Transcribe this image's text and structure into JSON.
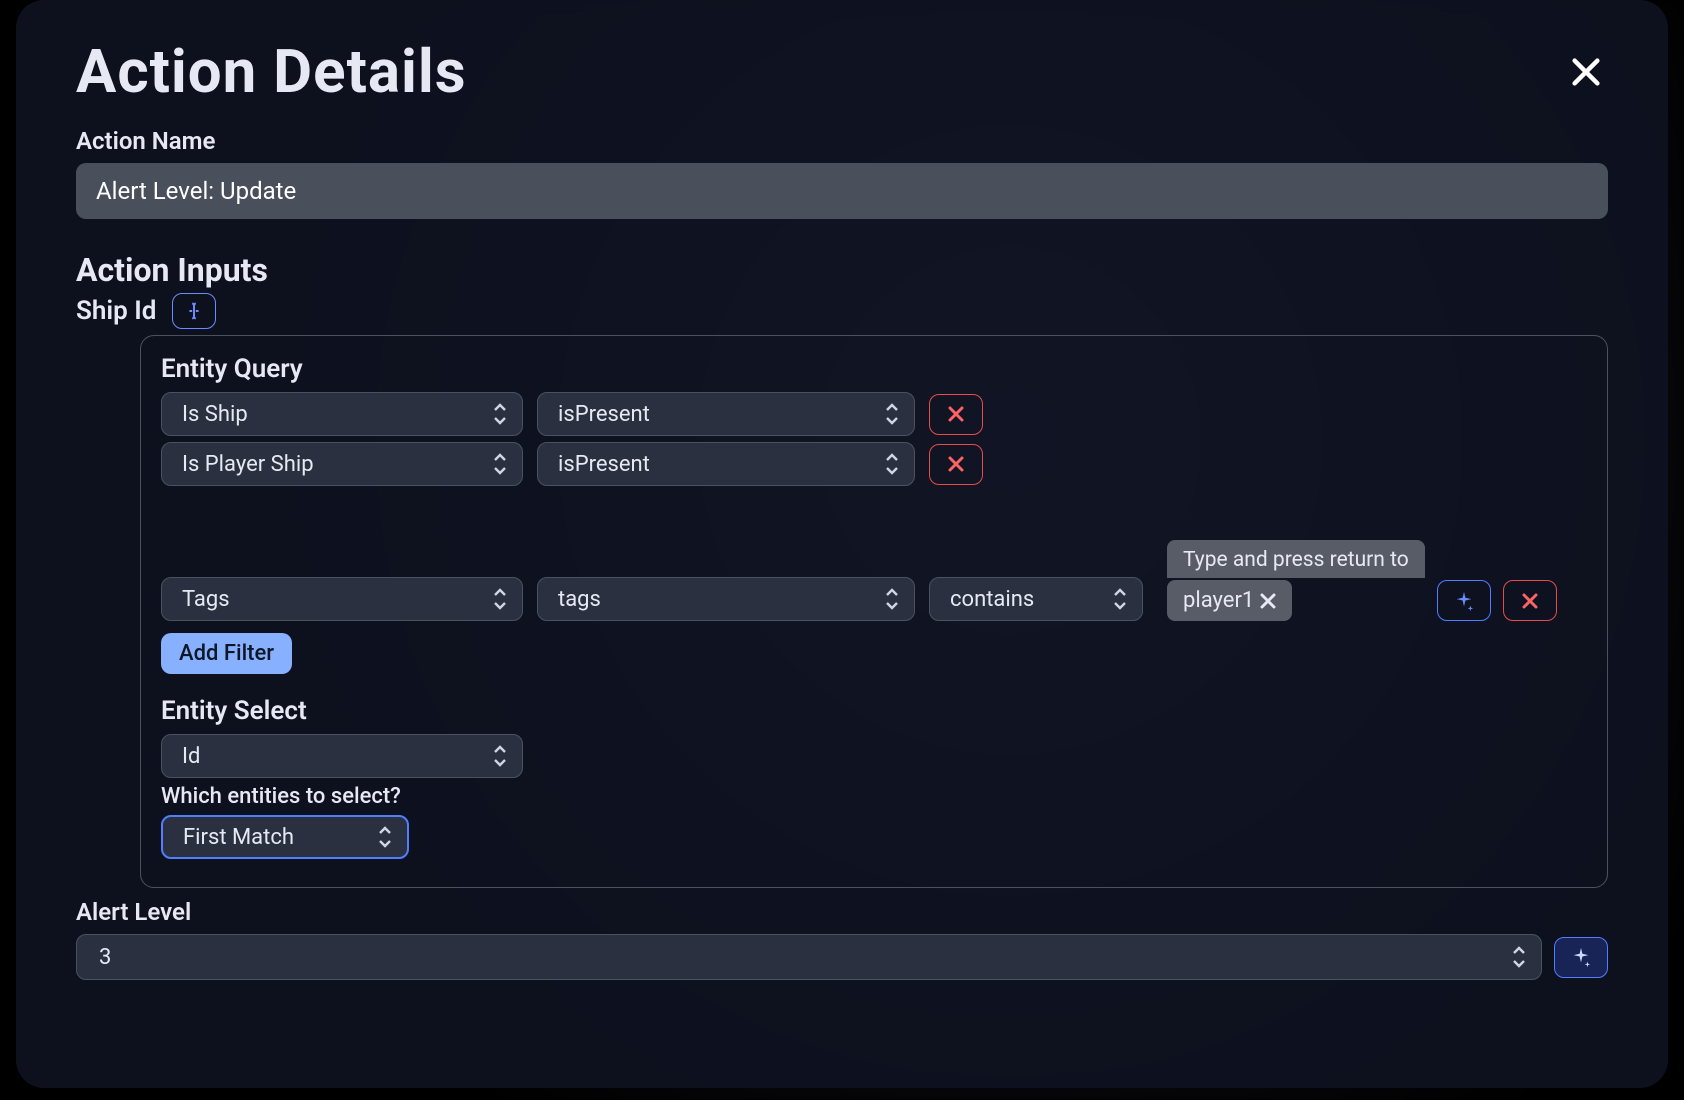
{
  "modal": {
    "title": "Action Details",
    "close_icon": "close"
  },
  "action_name": {
    "label": "Action Name",
    "value": "Alert Level: Update"
  },
  "inputs_section_title": "Action Inputs",
  "ship_id": {
    "label": "Ship Id"
  },
  "entity_query": {
    "heading": "Entity Query",
    "rows": [
      {
        "field": "Is Ship",
        "op": "isPresent"
      },
      {
        "field": "Is Player Ship",
        "op": "isPresent"
      }
    ],
    "tag_row": {
      "field": "Tags",
      "subfield": "tags",
      "op": "contains",
      "tag_hint": "Type and press return to",
      "tag_value": "player1"
    },
    "add_filter_label": "Add Filter"
  },
  "entity_select": {
    "heading": "Entity Select",
    "field": "Id",
    "which_label": "Which entities to select?",
    "which_value": "First Match"
  },
  "alert_level": {
    "label": "Alert Level",
    "value": "3"
  }
}
